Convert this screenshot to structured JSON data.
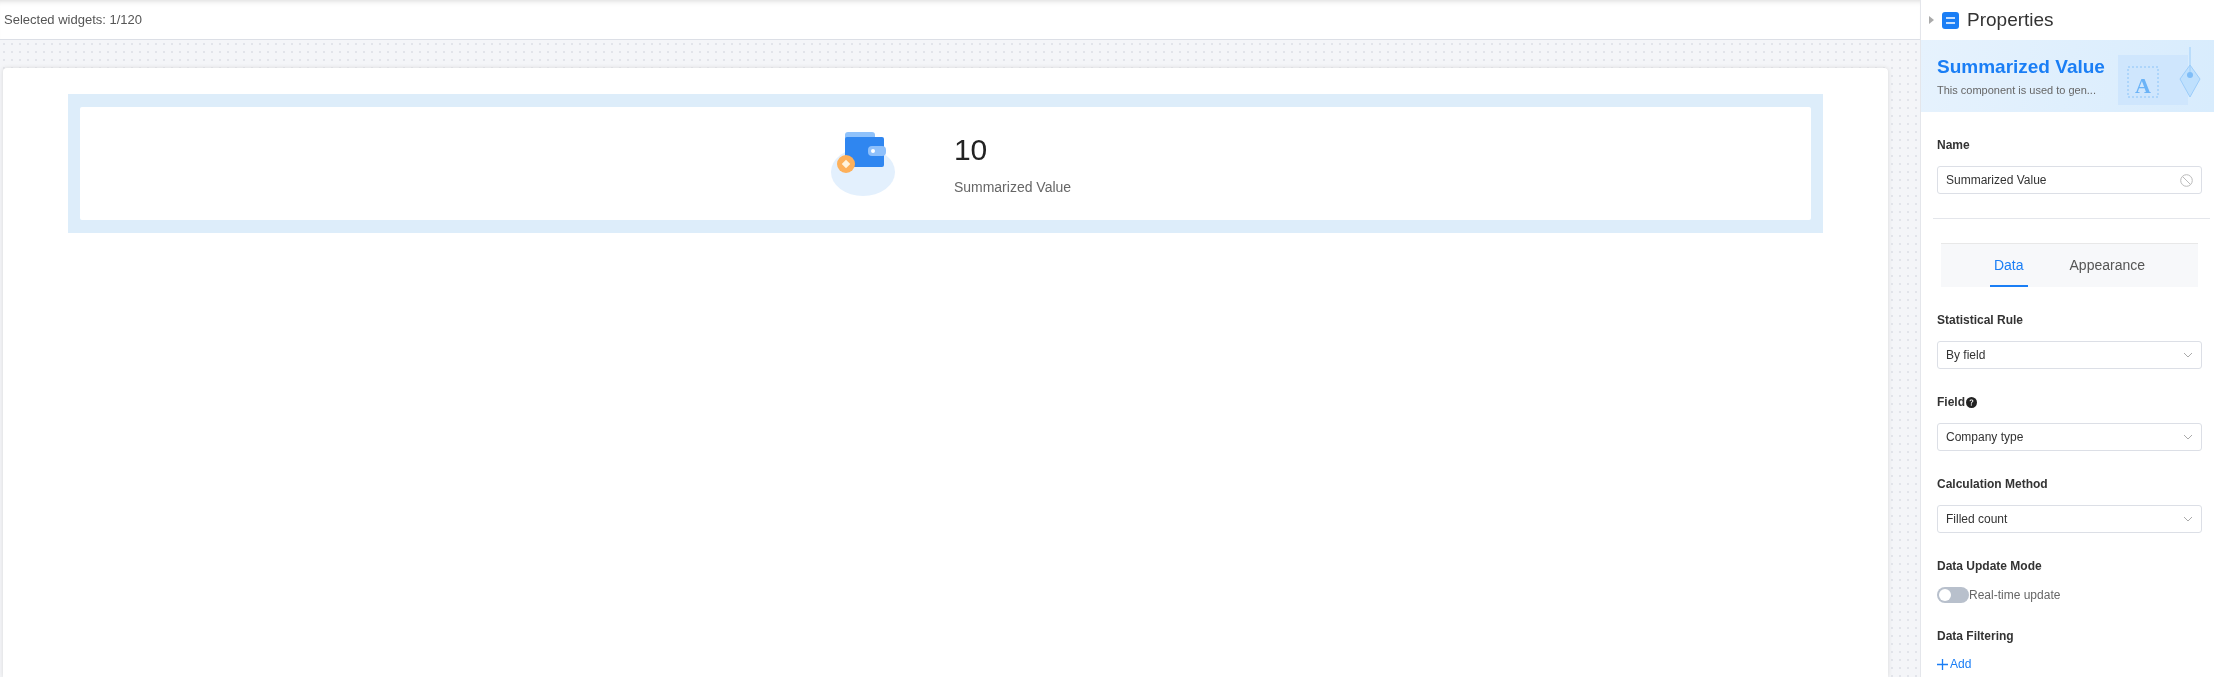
{
  "top_bar": {
    "selection_count": "Selected widgets: 1/120"
  },
  "widget": {
    "value": "10",
    "label": "Summarized Value"
  },
  "properties": {
    "title": "Properties",
    "banner": {
      "title": "Summarized Value",
      "description": "This component is used to gen...",
      "art_letter": "A"
    },
    "name": {
      "label": "Name",
      "value": "Summarized Value"
    },
    "tabs": [
      {
        "label": "Data",
        "selected": true
      },
      {
        "label": "Appearance",
        "selected": false
      }
    ],
    "fields": [
      {
        "kind": "select",
        "label": "Statistical Rule",
        "value": "By field",
        "help": false
      },
      {
        "kind": "select",
        "label": "Field",
        "value": "Company type",
        "help": true
      },
      {
        "kind": "select",
        "label": "Calculation Method",
        "value": "Filled count",
        "help": false
      },
      {
        "kind": "toggle",
        "label": "Data Update Mode",
        "value": "Real-time update",
        "on": false
      },
      {
        "kind": "add",
        "label": "Data Filtering",
        "value": "Add"
      }
    ]
  }
}
